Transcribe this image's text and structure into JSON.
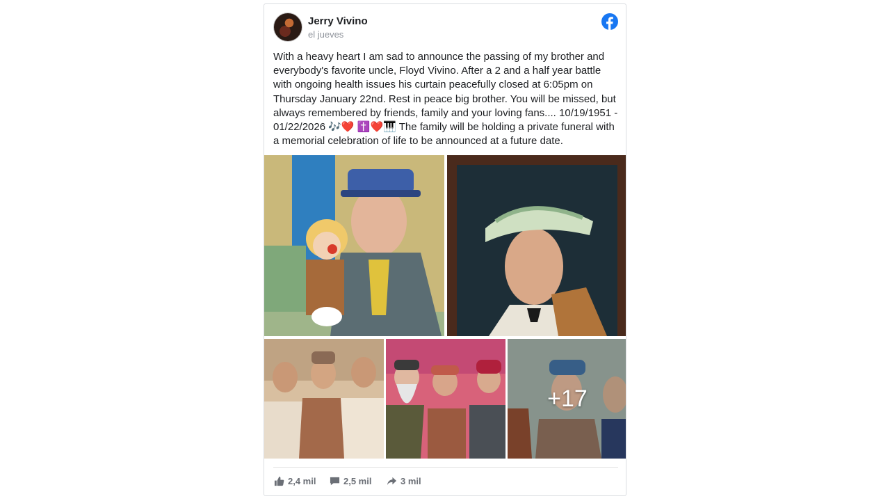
{
  "post": {
    "author": "Jerry Vivino",
    "timestamp": "el jueves",
    "text": "With a heavy heart I am sad to announce the passing of my brother and everybody's favorite uncle, Floyd Vivino. After a 2 and a half year battle with ongoing health issues his curtain peacefully closed at 6:05pm on Thursday January 22nd. Rest in peace big brother. You will be missed, but always remembered by friends, family and your loving fans.... 10/19/1951 - 01/22/2026 🎶❤️ ✝️❤️🎹 The family will be holding a private funeral with a memorial celebration of life to be announced at a future date."
  },
  "photos": {
    "more_count": "+17"
  },
  "stats": {
    "likes": "2,4 mil",
    "comments": "2,5 mil",
    "shares": "3 mil"
  },
  "icons": {
    "platform": "facebook-icon",
    "like": "thumbs-up-icon",
    "comment": "comment-icon",
    "share": "share-arrow-icon"
  },
  "colors": {
    "facebook_blue": "#1877f2"
  }
}
